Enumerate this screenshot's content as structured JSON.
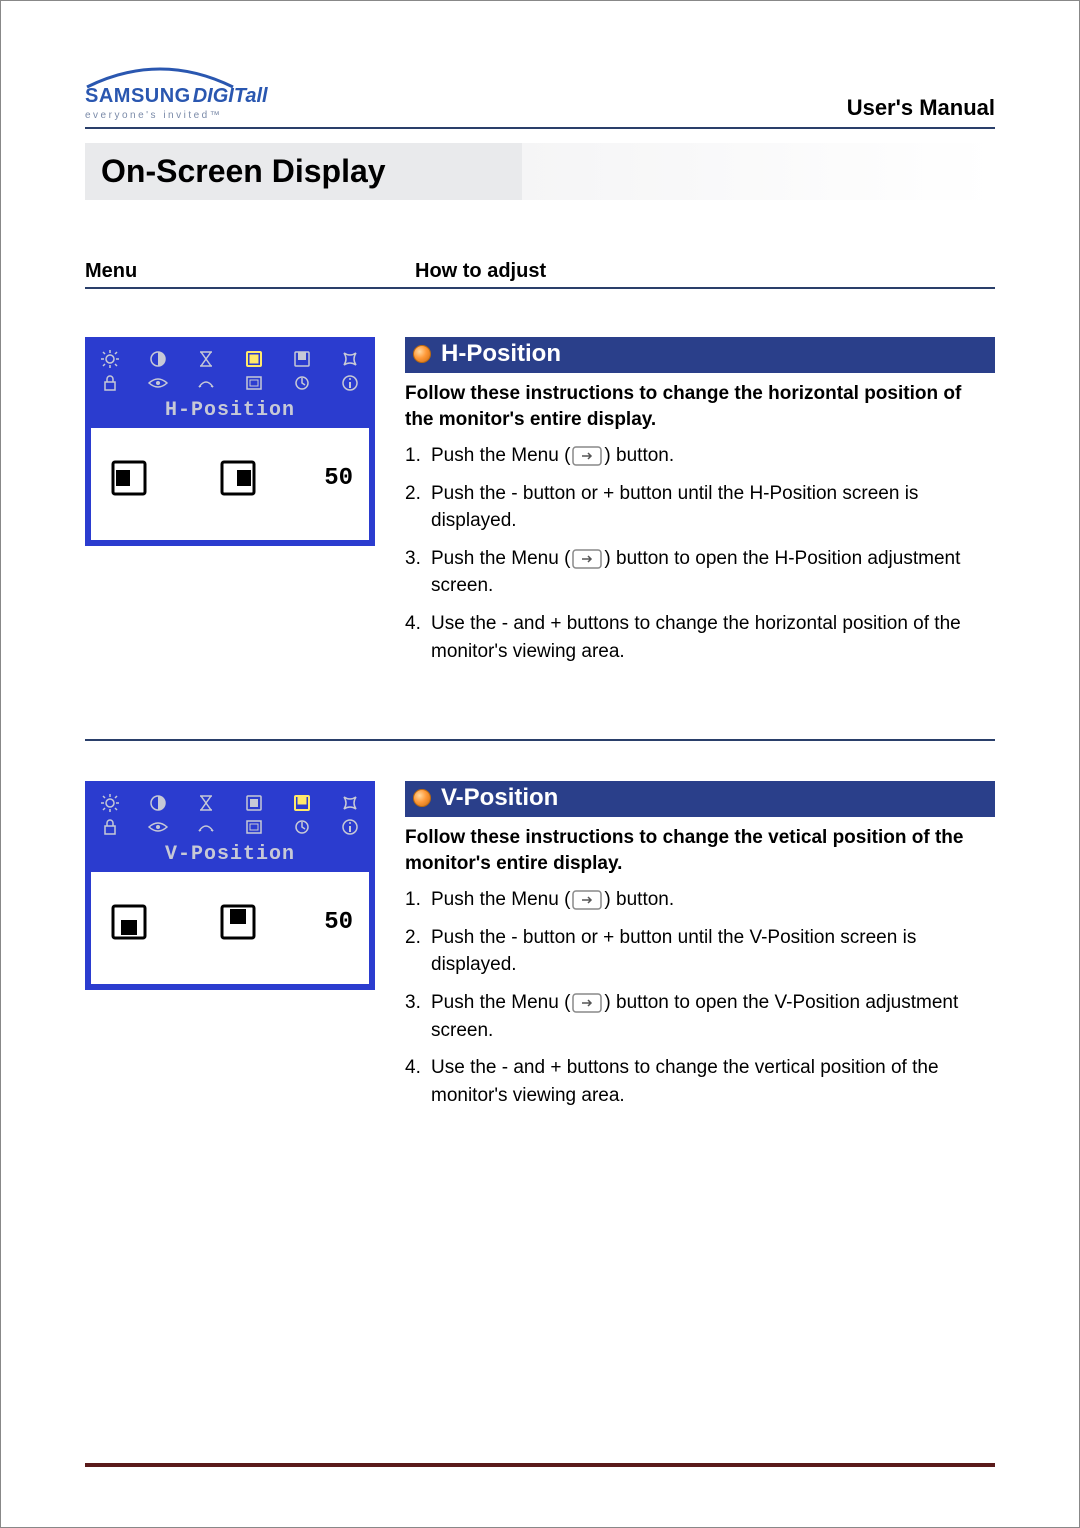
{
  "logo": {
    "brand_main": "SAMSUNG",
    "brand_sub": "DIGITall",
    "tagline": "everyone's invited™"
  },
  "header": {
    "manual_label": "User's Manual",
    "page_title": "On-Screen Display"
  },
  "columns": {
    "menu_label": "Menu",
    "howto_label": "How to adjust"
  },
  "sections": [
    {
      "osd_label": "H-Position",
      "osd_value": "50",
      "title": "H-Position",
      "lead": "Follow these instructions to change the horizontal position of the monitor's entire display.",
      "steps": [
        {
          "n": "1.",
          "pre": "Push the Menu (",
          "post": ") button."
        },
        {
          "n": "2.",
          "text": "Push the - button or + button until the H-Position screen is displayed."
        },
        {
          "n": "3.",
          "pre": "Push the Menu (",
          "post": ") button to open the H-Position adjustment screen."
        },
        {
          "n": "4.",
          "text": "Use the - and + buttons to change the horizontal position of the monitor's viewing area."
        }
      ]
    },
    {
      "osd_label": "V-Position",
      "osd_value": "50",
      "title": "V-Position",
      "lead": "Follow these instructions to change the vetical position of the monitor's entire display.",
      "steps": [
        {
          "n": "1.",
          "pre": "Push the Menu (",
          "post": ") button."
        },
        {
          "n": "2.",
          "text": "Push the - button or + button until the V-Position screen is displayed."
        },
        {
          "n": "3.",
          "pre": "Push the Menu (",
          "post": ") button to open the V-Position adjustment screen."
        },
        {
          "n": "4.",
          "text": "Use the - and + buttons to change the vertical position of the monitor's viewing area."
        }
      ]
    }
  ]
}
